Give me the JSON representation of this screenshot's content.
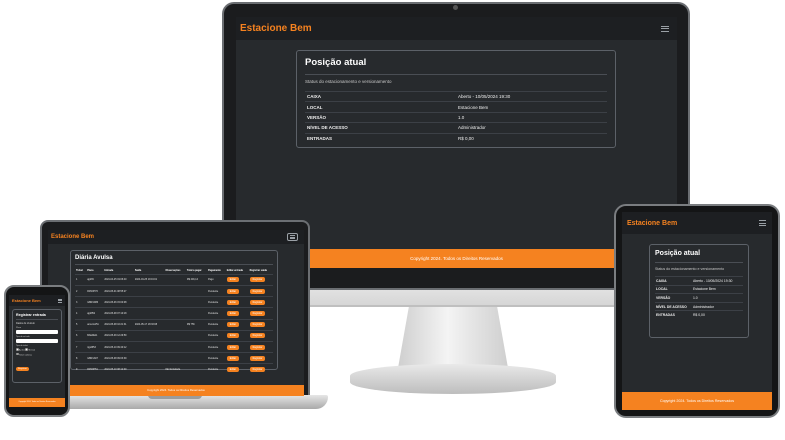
{
  "brand": "Estacione Bem",
  "footer": "Copyright 2024. Todos os Direitos Reservados",
  "status_card": {
    "title": "Posição atual",
    "subtitle": "Status do estacionamento e versionamento",
    "rows": [
      {
        "key": "CAIXA",
        "value": "Aberto - 10/05/2024 19:30"
      },
      {
        "key": "LOCAL",
        "value": "Estacione Bem"
      },
      {
        "key": "VERSÃO",
        "value": "1.0"
      },
      {
        "key": "NÍVEL DE ACESSO",
        "value": "Administrador"
      },
      {
        "key": "ENTRADAS",
        "value": "R$ 0,00"
      }
    ]
  },
  "laptop": {
    "title": "Diária Avulsa",
    "columns": [
      "Ticket",
      "Placa",
      "Entrada",
      "Saída",
      "Observações",
      "Total a pagar",
      "Pagamento",
      "Editar entrada",
      "Registrar saída"
    ],
    "edit_label": "Editar",
    "register_label": "Registrar",
    "rows": [
      [
        "1",
        "ajp8f4",
        "2024-04-25 19:06:40",
        "2024-04-25 19:19:01",
        "",
        "R$ 446,14",
        "Pago",
        "",
        ""
      ],
      [
        "2",
        "FRN0H76",
        "2024-05-01 08:55:27",
        "",
        "",
        "",
        "Pendente",
        "",
        ""
      ],
      [
        "3",
        "GBR1D86",
        "2024-05-06 15:00:08",
        "",
        "",
        "",
        "Pendente",
        "",
        ""
      ],
      [
        "4",
        "ajp8f52",
        "2024-05-08 07:10:18",
        "",
        "",
        "",
        "Pendente",
        "",
        ""
      ],
      [
        "5",
        "arsxcnsf51",
        "2024-05-08 16:21:31",
        "2024-05-17 18:33:08",
        "",
        "R$ 756",
        "Pendente",
        "",
        ""
      ],
      [
        "6",
        "BAE9E11",
        "2024-05-09 12:29:59",
        "",
        "",
        "",
        "Pendente",
        "",
        ""
      ],
      [
        "7",
        "rigo8f53",
        "2024-05-10 09:40:12",
        "",
        "",
        "",
        "Pendente",
        "",
        ""
      ],
      [
        "8",
        "GBR1A97",
        "2024-05-08 09:03:39",
        "",
        "",
        "",
        "Pendente",
        "",
        ""
      ],
      [
        "9",
        "FRN9H51",
        "2024-05-10 08:12:00",
        "",
        "#Emboladada",
        "",
        "Pendente",
        "",
        ""
      ]
    ]
  },
  "phone": {
    "title": "Registrar entrada",
    "section": "Dados do Veículo",
    "plate_label": "Placa",
    "type_label": "Tipo de veículo",
    "ticket_label": "Tipo de ticket",
    "radio_a": "Avulso",
    "radio_b": "Mensal",
    "radio_c": "Ticket cortesia",
    "submit": "Registrar"
  }
}
